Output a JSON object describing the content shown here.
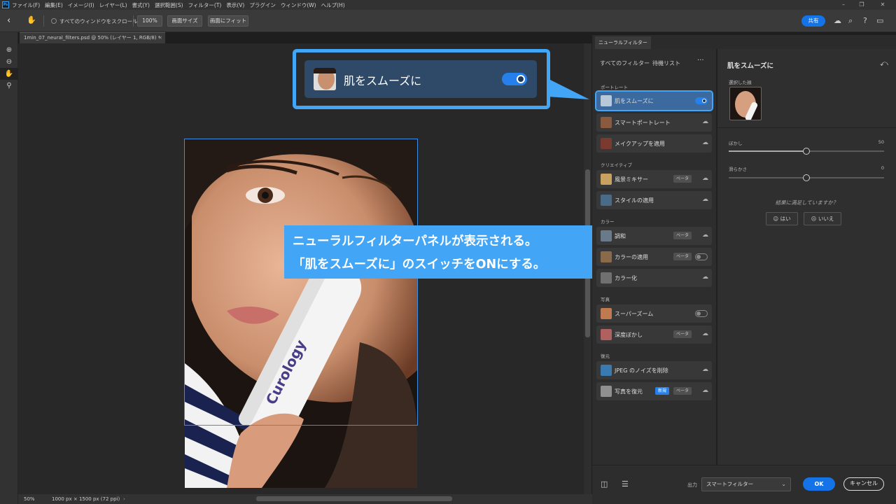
{
  "menu": [
    "ファイル(F)",
    "編集(E)",
    "イメージ(I)",
    "レイヤー(L)",
    "書式(Y)",
    "選択範囲(S)",
    "フィルター(T)",
    "表示(V)",
    "プラグイン",
    "ウィンドウ(W)",
    "ヘルプ(H)"
  ],
  "options": {
    "scroll_all": "すべてのウィンドウをスクロール",
    "zoom": "100%",
    "screen_size": "画面サイズ",
    "fit_screen": "画面にフィット",
    "share": "共有"
  },
  "document": {
    "tab": "1min_07_neural_filters.psd @ 50% (レイヤー 1, RGB/8) *",
    "zoom": "50%",
    "size": "1000 px × 1500 px (72 ppi)",
    "product_text": "Curology"
  },
  "callout": {
    "label": "肌をスムーズに",
    "toggle_on": true
  },
  "caption": {
    "line1": "ニューラルフィルターパネルが表示される。",
    "line2": "「肌をスムーズに」のスイッチをONにする。"
  },
  "neural_filters": {
    "panel_tab": "ニューラルフィルター",
    "tab_all": "すべてのフィルター",
    "tab_waitlist": "待機リスト",
    "categories": {
      "portrait": "ポートレート",
      "creative": "クリエイティブ",
      "color": "カラー",
      "photo": "写真",
      "restore": "復元"
    },
    "filters": {
      "skin_smooth": "肌をスムーズに",
      "smart_portrait": "スマートポートレート",
      "makeup": "メイクアップを適用",
      "landscape_mixer": "風景ミキサー",
      "style_transfer": "スタイルの適用",
      "harmonize": "調和",
      "color_transfer": "カラーの適用",
      "colorize": "カラー化",
      "super_zoom": "スーパーズーム",
      "depth_blur": "深度ぼかし",
      "jpeg_artifacts": "JPEG のノイズを削除",
      "photo_restore": "写真を復元"
    },
    "badges": {
      "beta": "ベータ",
      "new": "新規"
    }
  },
  "settings": {
    "title": "肌をスムーズに",
    "selected_face": "選択した顔",
    "blur_label": "ぼかし",
    "blur_value": "50",
    "blur_level": 50,
    "smooth_label": "滑らかさ",
    "smooth_value": "0",
    "smooth_level": 50,
    "question": "結果に満足していますか？",
    "yes": "はい",
    "no": "いいえ"
  },
  "footer": {
    "output_label": "出力",
    "output_value": "スマートフィルター",
    "ok": "OK",
    "cancel": "キャンセル"
  },
  "colors": {
    "accent": "#1473e6",
    "callout": "#42a5f5"
  }
}
